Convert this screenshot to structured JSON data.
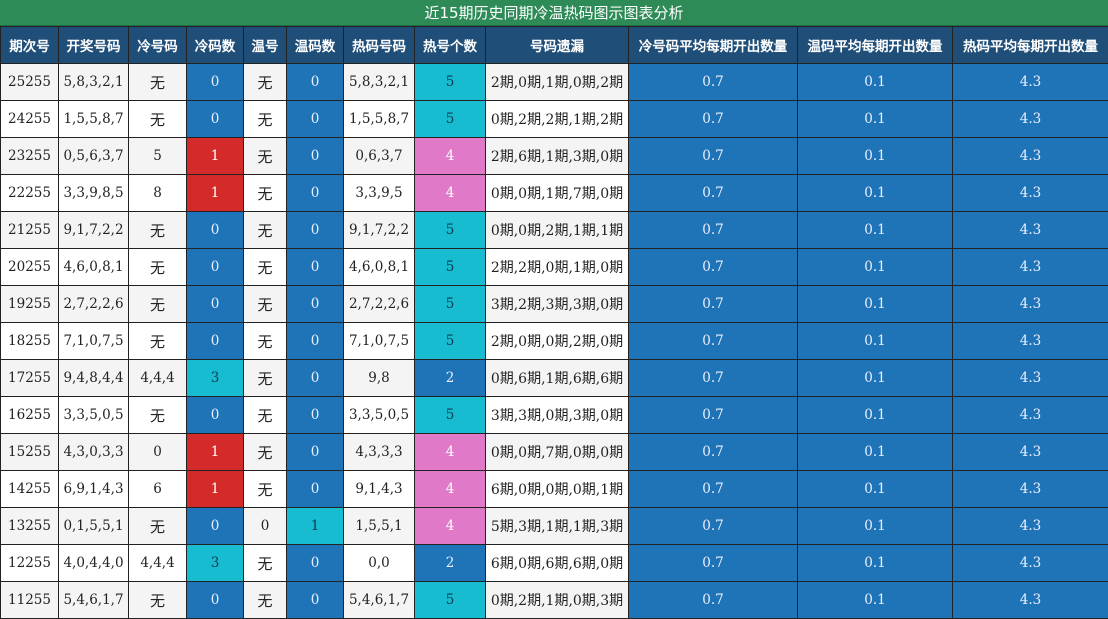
{
  "title": "近15期历史同期冷温热码图示图表分析",
  "headers": [
    "期次号",
    "开奖号码",
    "冷号码",
    "冷码数",
    "温号",
    "温码数",
    "热码号码",
    "热号个数",
    "号码遗漏",
    "冷号码平均每期开出数量",
    "温码平均每期开出数量",
    "热码平均每期开出数量"
  ],
  "colors": {
    "header": "#1f4e79",
    "title": "#2e8b57",
    "blue": "#1f73b7",
    "red": "#d42a2a",
    "cyan": "#17bcd0",
    "pink": "#e07ac8"
  },
  "rows": [
    {
      "period": "25255",
      "draw": "5,8,3,2,1",
      "cold": "无",
      "cold_count": "0",
      "warm": "无",
      "warm_count": "0",
      "hot": "5,8,3,2,1",
      "hot_count": "5",
      "miss": "2期,0期,1期,0期,2期",
      "cold_avg": "0.7",
      "warm_avg": "0.1",
      "hot_avg": "4.3"
    },
    {
      "period": "24255",
      "draw": "1,5,5,8,7",
      "cold": "无",
      "cold_count": "0",
      "warm": "无",
      "warm_count": "0",
      "hot": "1,5,5,8,7",
      "hot_count": "5",
      "miss": "0期,2期,2期,1期,2期",
      "cold_avg": "0.7",
      "warm_avg": "0.1",
      "hot_avg": "4.3"
    },
    {
      "period": "23255",
      "draw": "0,5,6,3,7",
      "cold": "5",
      "cold_count": "1",
      "warm": "无",
      "warm_count": "0",
      "hot": "0,6,3,7",
      "hot_count": "4",
      "miss": "2期,6期,1期,3期,0期",
      "cold_avg": "0.7",
      "warm_avg": "0.1",
      "hot_avg": "4.3"
    },
    {
      "period": "22255",
      "draw": "3,3,9,8,5",
      "cold": "8",
      "cold_count": "1",
      "warm": "无",
      "warm_count": "0",
      "hot": "3,3,9,5",
      "hot_count": "4",
      "miss": "0期,0期,1期,7期,0期",
      "cold_avg": "0.7",
      "warm_avg": "0.1",
      "hot_avg": "4.3"
    },
    {
      "period": "21255",
      "draw": "9,1,7,2,2",
      "cold": "无",
      "cold_count": "0",
      "warm": "无",
      "warm_count": "0",
      "hot": "9,1,7,2,2",
      "hot_count": "5",
      "miss": "0期,0期,2期,1期,1期",
      "cold_avg": "0.7",
      "warm_avg": "0.1",
      "hot_avg": "4.3"
    },
    {
      "period": "20255",
      "draw": "4,6,0,8,1",
      "cold": "无",
      "cold_count": "0",
      "warm": "无",
      "warm_count": "0",
      "hot": "4,6,0,8,1",
      "hot_count": "5",
      "miss": "2期,2期,0期,1期,0期",
      "cold_avg": "0.7",
      "warm_avg": "0.1",
      "hot_avg": "4.3"
    },
    {
      "period": "19255",
      "draw": "2,7,2,2,6",
      "cold": "无",
      "cold_count": "0",
      "warm": "无",
      "warm_count": "0",
      "hot": "2,7,2,2,6",
      "hot_count": "5",
      "miss": "3期,2期,3期,3期,0期",
      "cold_avg": "0.7",
      "warm_avg": "0.1",
      "hot_avg": "4.3"
    },
    {
      "period": "18255",
      "draw": "7,1,0,7,5",
      "cold": "无",
      "cold_count": "0",
      "warm": "无",
      "warm_count": "0",
      "hot": "7,1,0,7,5",
      "hot_count": "5",
      "miss": "2期,0期,0期,2期,0期",
      "cold_avg": "0.7",
      "warm_avg": "0.1",
      "hot_avg": "4.3"
    },
    {
      "period": "17255",
      "draw": "9,4,8,4,4",
      "cold": "4,4,4",
      "cold_count": "3",
      "warm": "无",
      "warm_count": "0",
      "hot": "9,8",
      "hot_count": "2",
      "miss": "0期,6期,1期,6期,6期",
      "cold_avg": "0.7",
      "warm_avg": "0.1",
      "hot_avg": "4.3"
    },
    {
      "period": "16255",
      "draw": "3,3,5,0,5",
      "cold": "无",
      "cold_count": "0",
      "warm": "无",
      "warm_count": "0",
      "hot": "3,3,5,0,5",
      "hot_count": "5",
      "miss": "3期,3期,0期,3期,0期",
      "cold_avg": "0.7",
      "warm_avg": "0.1",
      "hot_avg": "4.3"
    },
    {
      "period": "15255",
      "draw": "4,3,0,3,3",
      "cold": "0",
      "cold_count": "1",
      "warm": "无",
      "warm_count": "0",
      "hot": "4,3,3,3",
      "hot_count": "4",
      "miss": "0期,0期,7期,0期,0期",
      "cold_avg": "0.7",
      "warm_avg": "0.1",
      "hot_avg": "4.3"
    },
    {
      "period": "14255",
      "draw": "6,9,1,4,3",
      "cold": "6",
      "cold_count": "1",
      "warm": "无",
      "warm_count": "0",
      "hot": "9,1,4,3",
      "hot_count": "4",
      "miss": "6期,0期,0期,0期,1期",
      "cold_avg": "0.7",
      "warm_avg": "0.1",
      "hot_avg": "4.3"
    },
    {
      "period": "13255",
      "draw": "0,1,5,5,1",
      "cold": "无",
      "cold_count": "0",
      "warm": "0",
      "warm_count": "1",
      "hot": "1,5,5,1",
      "hot_count": "4",
      "miss": "5期,3期,1期,1期,3期",
      "cold_avg": "0.7",
      "warm_avg": "0.1",
      "hot_avg": "4.3"
    },
    {
      "period": "12255",
      "draw": "4,0,4,4,0",
      "cold": "4,4,4",
      "cold_count": "3",
      "warm": "无",
      "warm_count": "0",
      "hot": "0,0",
      "hot_count": "2",
      "miss": "6期,0期,6期,6期,0期",
      "cold_avg": "0.7",
      "warm_avg": "0.1",
      "hot_avg": "4.3"
    },
    {
      "period": "11255",
      "draw": "5,4,6,1,7",
      "cold": "无",
      "cold_count": "0",
      "warm": "无",
      "warm_count": "0",
      "hot": "5,4,6,1,7",
      "hot_count": "5",
      "miss": "0期,2期,1期,0期,3期",
      "cold_avg": "0.7",
      "warm_avg": "0.1",
      "hot_avg": "4.3"
    }
  ]
}
